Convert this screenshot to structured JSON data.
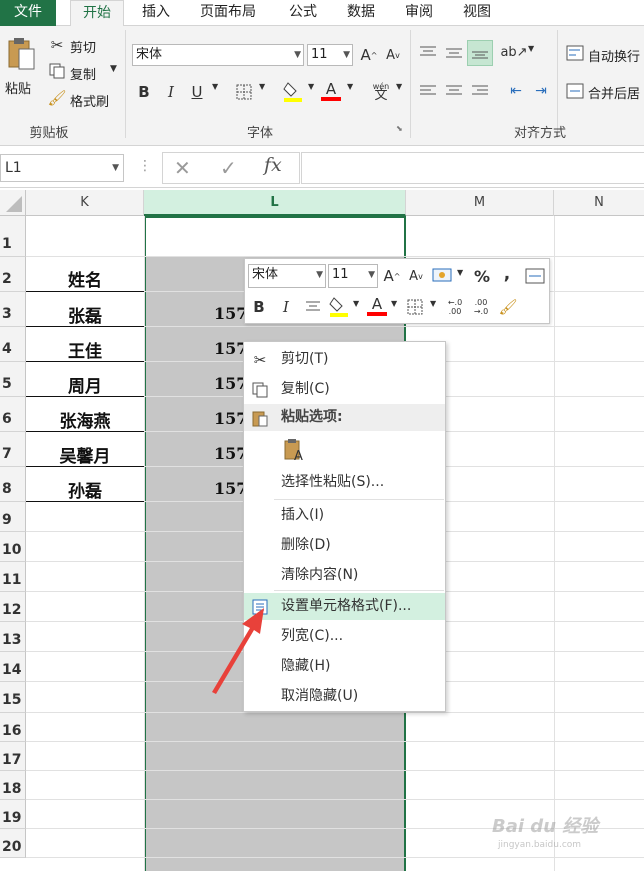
{
  "tabs": {
    "file": "文件",
    "home": "开始",
    "insert": "插入",
    "layout": "页面布局",
    "formulas": "公式",
    "data": "数据",
    "review": "审阅",
    "view": "视图"
  },
  "clipboard": {
    "paste": "粘贴",
    "cut": "剪切",
    "copy": "复制",
    "painter": "格式刷",
    "group": "剪贴板"
  },
  "font": {
    "name": "宋体",
    "size": "11",
    "bold": "B",
    "italic": "I",
    "underline": "U",
    "color_letter": "A",
    "phonetic": "wén",
    "group": "字体"
  },
  "align": {
    "wrap": "自动换行",
    "merge": "合并后居",
    "group": "对齐方式"
  },
  "formula_bar": {
    "namebox": "L1",
    "fx": "fx",
    "dots": "⋮"
  },
  "columns": [
    "K",
    "L",
    "M",
    "N"
  ],
  "rows": [
    "1",
    "2",
    "3",
    "4",
    "5",
    "6",
    "7",
    "8",
    "9",
    "10",
    "11",
    "12",
    "13",
    "14",
    "15",
    "16",
    "17",
    "18",
    "19",
    "20"
  ],
  "names": [
    "姓名",
    "张磊",
    "王佳",
    "周月",
    "张海燕",
    "吴馨月",
    "孙磊"
  ],
  "l_values": [
    "157",
    "157",
    "157",
    "157",
    "157",
    "157"
  ],
  "mini": {
    "font": "宋体",
    "size": "11",
    "percent": "%",
    "comma": ",",
    "bold": "B",
    "italic": "I",
    "color_letter": "A"
  },
  "menu": {
    "cut": "剪切(T)",
    "copy": "复制(C)",
    "paste_header": "粘贴选项:",
    "paste_special": "选择性粘贴(S)...",
    "insert": "插入(I)",
    "delete": "删除(D)",
    "clear": "清除内容(N)",
    "format": "设置单元格格式(F)...",
    "width": "列宽(C)...",
    "hide": "隐藏(H)",
    "unhide": "取消隐藏(U)"
  },
  "watermark": {
    "brand": "Bai du 经验",
    "url": "jingyan.baidu.com"
  },
  "colors": {
    "excel_green": "#217346",
    "selection": "#c6c6c6",
    "highlight": "#d3f0e0",
    "arrow": "#e8413a",
    "font_red": "#ff0000",
    "fill_yellow": "#ffff00"
  }
}
